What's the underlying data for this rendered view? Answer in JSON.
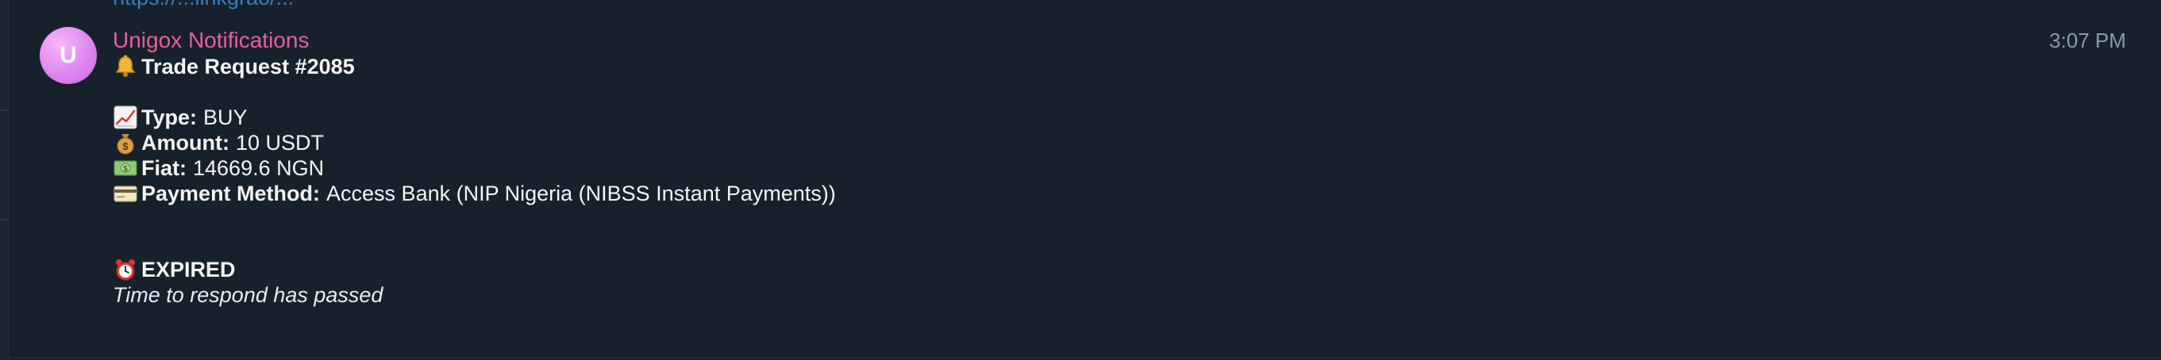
{
  "chat": {
    "top_link": "https://...linkgrao/...",
    "message": {
      "avatar_letter": "U",
      "sender": "Unigox Notifications",
      "time": "3:07 PM",
      "title": "Trade Request #2085",
      "fields": [
        {
          "label": "Type:",
          "value": "BUY",
          "icon": "chart-increasing-icon"
        },
        {
          "label": "Amount:",
          "value": "10 USDT",
          "icon": "money-bag-icon"
        },
        {
          "label": "Fiat:",
          "value": "14669.6 NGN",
          "icon": "dollar-banknote-icon"
        },
        {
          "label": "Payment Method:",
          "value": "Access Bank (NIP Nigeria (NIBSS Instant Payments))",
          "icon": "credit-card-icon"
        }
      ],
      "status": "EXPIRED",
      "note": "Time to respond has passed"
    }
  },
  "colors": {
    "background": "#17212b",
    "sender": "#ee5d9c",
    "time": "#8a98a8",
    "link": "#3d8fd6",
    "avatar": "#de87ef"
  }
}
